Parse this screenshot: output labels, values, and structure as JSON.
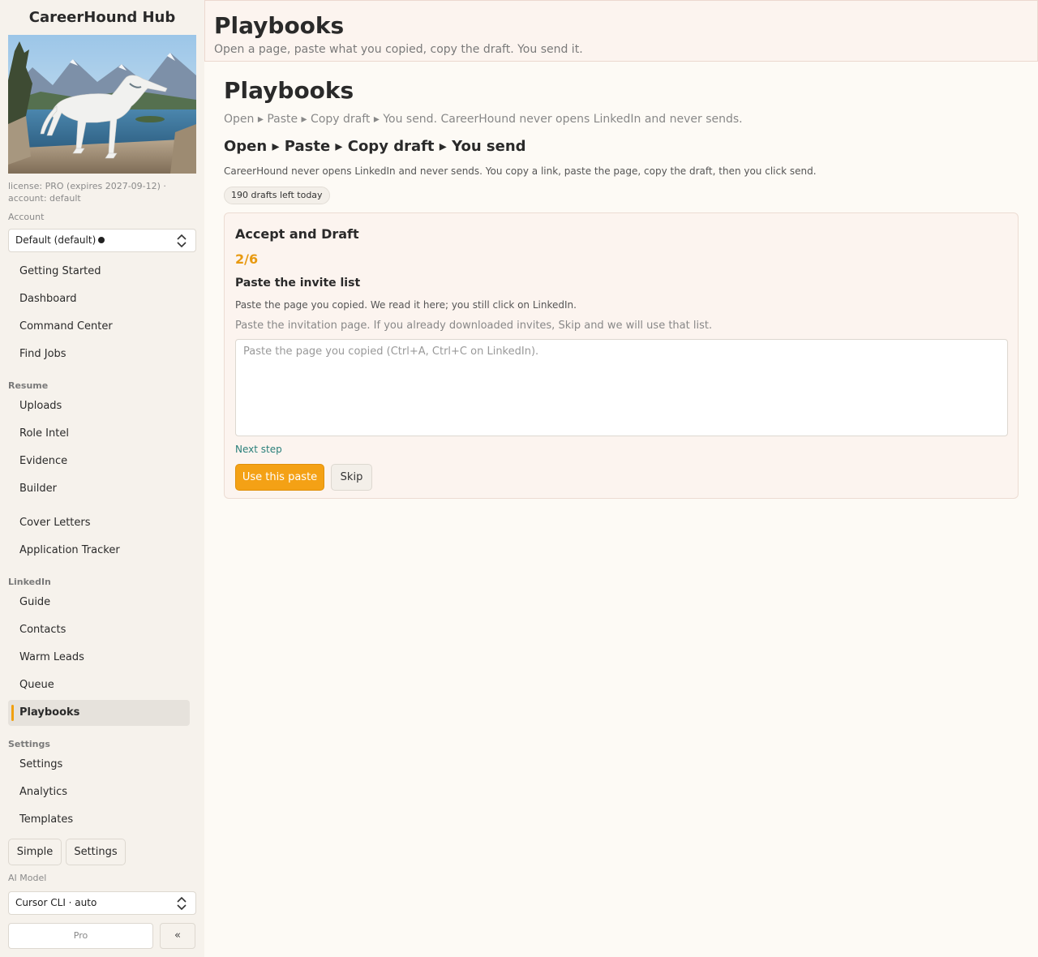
{
  "app": {
    "brand": "CareerHound Hub"
  },
  "sidebar": {
    "license": "license: PRO (expires 2027-09-12) · account: default",
    "account_label": "Account",
    "account_value": "Default (default)",
    "nav_main": [
      "Getting Started",
      "Dashboard",
      "Command Center",
      "Find Jobs"
    ],
    "resume_label": "Resume",
    "nav_resume": [
      "Uploads",
      "Role Intel",
      "Evidence",
      "Builder"
    ],
    "nav_other": [
      "Cover Letters",
      "Application Tracker"
    ],
    "linkedin_label": "LinkedIn",
    "nav_linkedin": [
      "Guide",
      "Contacts",
      "Warm Leads",
      "Queue",
      "Playbooks"
    ],
    "settings_label": "Settings",
    "nav_settings": [
      "Settings",
      "Analytics",
      "Templates"
    ],
    "btn_simple": "Simple",
    "btn_settings": "Settings",
    "ai_label": "AI Model",
    "ai_value": "Cursor CLI · auto",
    "btn_pro": "Pro",
    "btn_collapse": "«"
  },
  "header": {
    "title": "Playbooks",
    "subtitle": "Open a page, paste what you copied, copy the draft. You send it."
  },
  "main": {
    "title": "Playbooks",
    "subtitle": "Open ▸ Paste ▸ Copy draft ▸ You send. CareerHound never opens LinkedIn and never sends.",
    "heading": "Open ▸ Paste ▸ Copy draft ▸ You send",
    "description": "CareerHound never opens LinkedIn and never sends. You copy a link, paste the page, copy the draft, then you click send.",
    "badge": "190 drafts left today"
  },
  "card": {
    "title": "Accept and Draft",
    "step": "2/6",
    "step_title": "Paste the invite list",
    "step_desc": "Paste the page you copied. We read it here; you still click on LinkedIn.",
    "step_hint": "Paste the invitation page. If you already downloaded invites, Skip and we will use that list.",
    "paste_placeholder": "Paste the page you copied (Ctrl+A, Ctrl+C on LinkedIn).",
    "next_link": "Next step",
    "btn_use": "Use this paste",
    "btn_skip": "Skip"
  }
}
